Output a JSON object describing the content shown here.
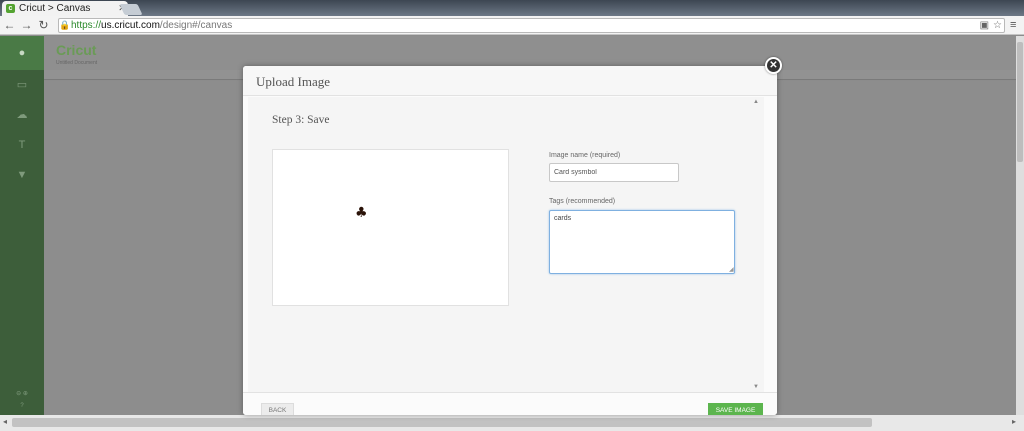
{
  "browser": {
    "tab_title": "Cricut > Canvas",
    "url_scheme": "https://",
    "url_host": "us.cricut.com",
    "url_path": "/design#/canvas"
  },
  "app": {
    "logo": "Cricut",
    "document_name": "Untitled Document"
  },
  "modal": {
    "title": "Upload Image",
    "step_title": "Step 3: Save",
    "name_label": "Image name (required)",
    "name_value": "Card sysmbol",
    "tags_label": "Tags (recommended)",
    "tags_value": "cards",
    "preview_icon": "club-symbol-icon",
    "back_label": "BACK",
    "save_label": "SAVE IMAGE"
  },
  "colors": {
    "accent": "#5cb54e",
    "overlay": "#8c8c8c"
  }
}
